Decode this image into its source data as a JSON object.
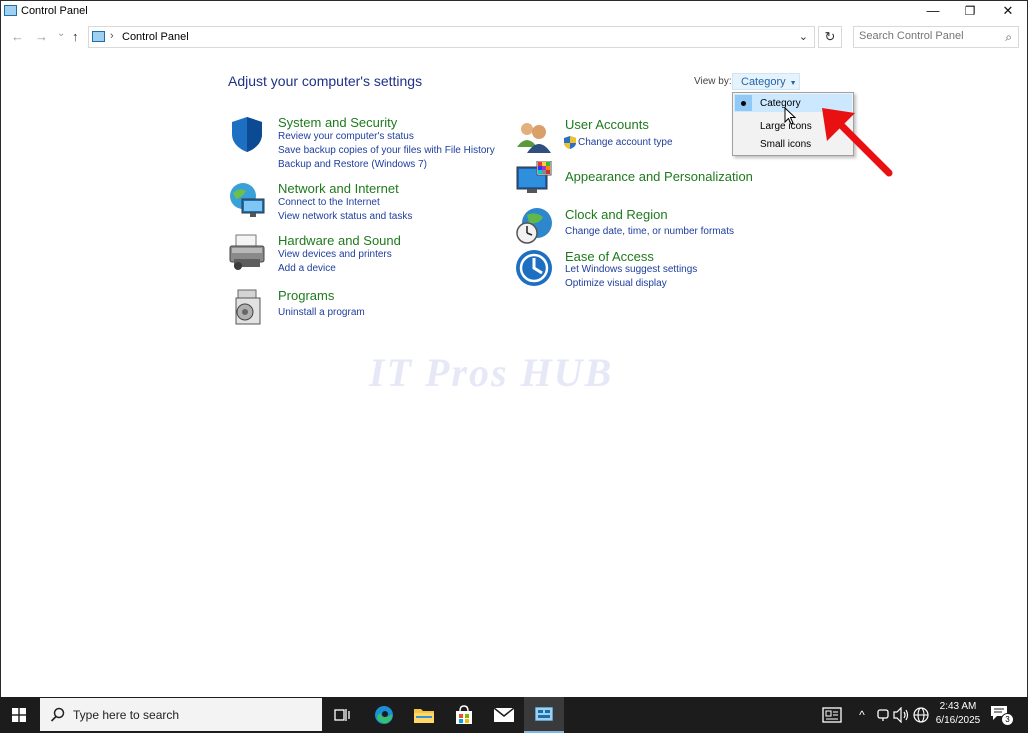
{
  "window": {
    "title": "Control Panel",
    "minimize": "—",
    "restore": "❐",
    "close": "✕"
  },
  "nav": {
    "back": "←",
    "forward": "→",
    "recent": "⌄",
    "up": "↑",
    "breadcrumb_sep": "›",
    "address": "Control Panel",
    "address_dropdown": "⌄",
    "refresh": "↻",
    "search_placeholder": "Search Control Panel",
    "search_icon": "⌕"
  },
  "main": {
    "heading": "Adjust your computer's settings",
    "view_by_label": "View by:",
    "view_by_value": "Category",
    "view_by_caret": "▼"
  },
  "view_menu": {
    "items": [
      {
        "label": "Category",
        "selected": true
      },
      {
        "label": "Large icons",
        "selected": false
      },
      {
        "label": "Small icons",
        "selected": false
      }
    ]
  },
  "categories_left": [
    {
      "title": "System and Security",
      "links": [
        "Review your computer's status",
        "Save backup copies of your files with File History",
        "Backup and Restore (Windows 7)"
      ]
    },
    {
      "title": "Network and Internet",
      "links": [
        "Connect to the Internet",
        "View network status and tasks"
      ]
    },
    {
      "title": "Hardware and Sound",
      "links": [
        "View devices and printers",
        "Add a device"
      ]
    },
    {
      "title": "Programs",
      "links": [
        "Uninstall a program"
      ]
    }
  ],
  "categories_right": [
    {
      "title": "User Accounts",
      "links": [
        "Change account type"
      ]
    },
    {
      "title": "Appearance and Personalization",
      "links": []
    },
    {
      "title": "Clock and Region",
      "links": [
        "Change date, time, or number formats"
      ]
    },
    {
      "title": "Ease of Access",
      "links": [
        "Let Windows suggest settings",
        "Optimize visual display"
      ]
    }
  ],
  "watermark": "IT Pros HUB",
  "taskbar": {
    "search_placeholder": "Type here to search",
    "time": "2:43 AM",
    "date": "6/16/2025",
    "notification_count": "3",
    "tray_up": "^"
  },
  "colors": {
    "category_title": "#1e7a1e",
    "link": "#1e3e9e",
    "heading": "#1e3287",
    "taskbar": "#1c1c1c",
    "arrow": "#e81010"
  }
}
